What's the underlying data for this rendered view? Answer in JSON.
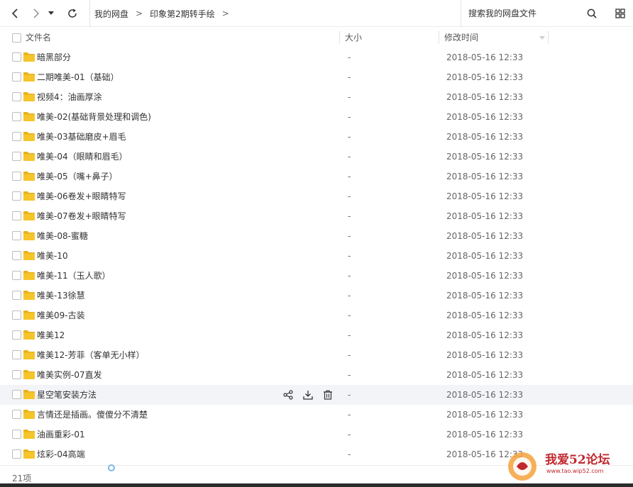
{
  "breadcrumb": [
    "我的网盘",
    "印象第2期转手绘"
  ],
  "search": {
    "placeholder": "搜索我的网盘文件"
  },
  "columns": {
    "name": "文件名",
    "size": "大小",
    "modified": "修改时间"
  },
  "files": [
    {
      "name": "暗黑部分",
      "size": "-",
      "modified": "2018-05-16 12:33"
    },
    {
      "name": "二期唯美-01（基础）",
      "size": "-",
      "modified": "2018-05-16 12:33"
    },
    {
      "name": "视频4：油画厚涂",
      "size": "-",
      "modified": "2018-05-16 12:33"
    },
    {
      "name": "唯美-02(基础背景处理和调色)",
      "size": "-",
      "modified": "2018-05-16 12:33"
    },
    {
      "name": "唯美-03基础磨皮+眉毛",
      "size": "-",
      "modified": "2018-05-16 12:33"
    },
    {
      "name": "唯美-04（眼睛和眉毛）",
      "size": "-",
      "modified": "2018-05-16 12:33"
    },
    {
      "name": "唯美-05（嘴+鼻子）",
      "size": "-",
      "modified": "2018-05-16 12:33"
    },
    {
      "name": "唯美-06卷发+眼睛特写",
      "size": "-",
      "modified": "2018-05-16 12:33"
    },
    {
      "name": "唯美-07卷发+眼睛特写",
      "size": "-",
      "modified": "2018-05-16 12:33"
    },
    {
      "name": "唯美-08-蜜糖",
      "size": "-",
      "modified": "2018-05-16 12:33"
    },
    {
      "name": "唯美-10",
      "size": "-",
      "modified": "2018-05-16 12:33"
    },
    {
      "name": "唯美-11（玉人歌）",
      "size": "-",
      "modified": "2018-05-16 12:33"
    },
    {
      "name": "唯美-13徐慧",
      "size": "-",
      "modified": "2018-05-16 12:33"
    },
    {
      "name": "唯美09-古装",
      "size": "-",
      "modified": "2018-05-16 12:33"
    },
    {
      "name": "唯美12",
      "size": "-",
      "modified": "2018-05-16 12:33"
    },
    {
      "name": "唯美12-芳菲（客单无小样）",
      "size": "-",
      "modified": "2018-05-16 12:33"
    },
    {
      "name": "唯美实例-07直发",
      "size": "-",
      "modified": "2018-05-16 12:33"
    },
    {
      "name": "星空笔安装方法",
      "size": "-",
      "modified": "2018-05-16 12:33",
      "hovered": true
    },
    {
      "name": "言情还是插画。傻傻分不清楚",
      "size": "-",
      "modified": "2018-05-16 12:33"
    },
    {
      "name": "油画重彩-01",
      "size": "-",
      "modified": "2018-05-16 12:33"
    },
    {
      "name": "炫彩-04高端",
      "size": "-",
      "modified": "2018-05-16 12:33"
    }
  ],
  "footer": {
    "count": "21项"
  },
  "watermark": {
    "text": "我爱52论坛",
    "url": "www.tao.wip52.com"
  },
  "colors": {
    "folder": "#f5c52b",
    "folder_tab": "#e8b21c",
    "hover_row": "#f3f4f7",
    "spinner": "#7ab8e6",
    "watermark": "#c1272d"
  },
  "icons": [
    "back-icon",
    "forward-icon",
    "dropdown-icon",
    "refresh-icon",
    "search-icon",
    "grid-view-icon",
    "folder-icon",
    "share-icon",
    "download-icon",
    "delete-icon"
  ]
}
